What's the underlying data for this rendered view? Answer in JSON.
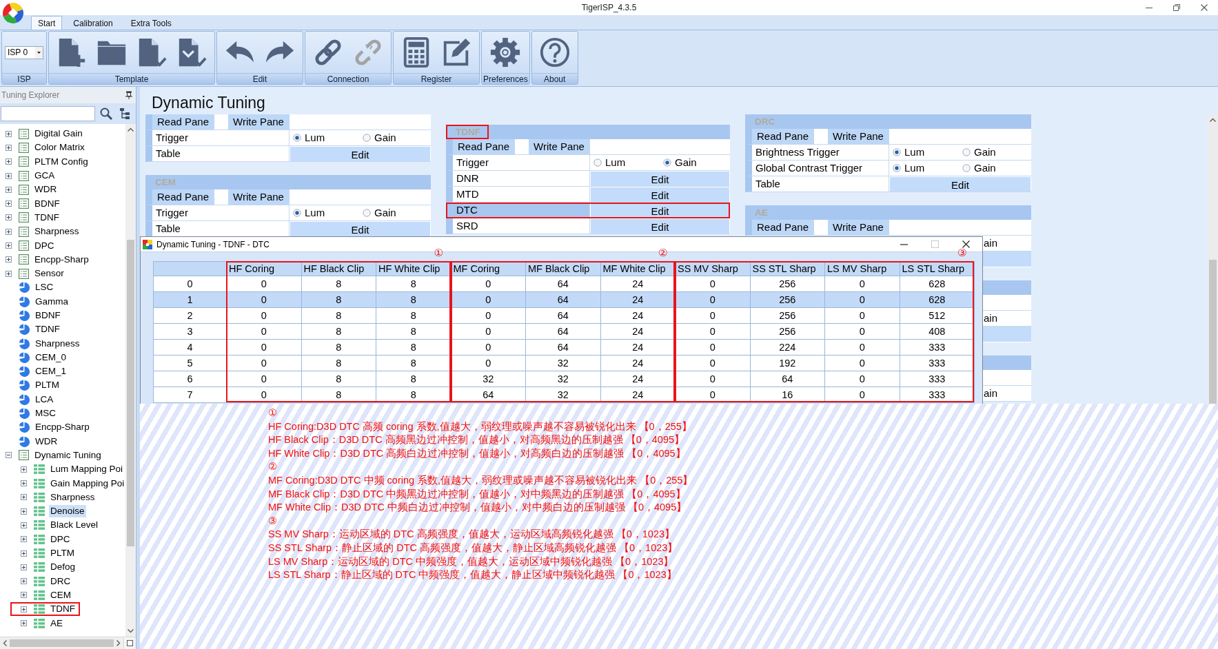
{
  "window": {
    "title": "TigerISP_4.3.5"
  },
  "ribbon": {
    "tabs": [
      {
        "label": "Start",
        "selected": true
      },
      {
        "label": "Calibration",
        "selected": false
      },
      {
        "label": "Extra Tools",
        "selected": false
      }
    ],
    "groups": [
      {
        "label": "ISP",
        "kind": "select",
        "value": "ISP 0"
      },
      {
        "label": "Template",
        "kind": "tools",
        "tools": [
          {
            "kind": "new-file",
            "disabled": false
          },
          {
            "kind": "folder",
            "disabled": false
          },
          {
            "kind": "save",
            "disabled": false
          },
          {
            "kind": "save-all",
            "disabled": false
          }
        ]
      },
      {
        "label": "Edit",
        "kind": "tools",
        "tools": [
          {
            "kind": "undo",
            "disabled": false
          },
          {
            "kind": "redo",
            "disabled": false
          }
        ]
      },
      {
        "label": "Connection",
        "kind": "tools",
        "tools": [
          {
            "kind": "link",
            "disabled": false
          },
          {
            "kind": "unlink",
            "disabled": true
          }
        ]
      },
      {
        "label": "Register",
        "kind": "tools",
        "tools": [
          {
            "kind": "calculator",
            "disabled": false
          },
          {
            "kind": "edit",
            "disabled": false
          }
        ]
      },
      {
        "label": "Preferences",
        "kind": "tools",
        "tools": [
          {
            "kind": "gear",
            "disabled": false
          }
        ]
      },
      {
        "label": "About",
        "kind": "tools",
        "tools": [
          {
            "kind": "help",
            "disabled": false
          }
        ]
      }
    ]
  },
  "explorer": {
    "title": "Tuning Explorer",
    "items": [
      {
        "label": "Digital Gain",
        "kind": "table",
        "expanded": false,
        "selected": false,
        "marked": false
      },
      {
        "label": "Color Matrix",
        "kind": "table",
        "expanded": false,
        "selected": false,
        "marked": false
      },
      {
        "label": "PLTM Config",
        "kind": "table",
        "expanded": false,
        "selected": false,
        "marked": false
      },
      {
        "label": "GCA",
        "kind": "table",
        "expanded": false,
        "selected": false,
        "marked": false
      },
      {
        "label": "WDR",
        "kind": "table",
        "expanded": false,
        "selected": false,
        "marked": false
      },
      {
        "label": "BDNF",
        "kind": "table",
        "expanded": false,
        "selected": false,
        "marked": false
      },
      {
        "label": "TDNF",
        "kind": "table",
        "expanded": false,
        "selected": false,
        "marked": false
      },
      {
        "label": "Sharpness",
        "kind": "table",
        "expanded": false,
        "selected": false,
        "marked": false
      },
      {
        "label": "DPC",
        "kind": "table",
        "expanded": false,
        "selected": false,
        "marked": false
      },
      {
        "label": "Encpp-Sharp",
        "kind": "table",
        "expanded": false,
        "selected": false,
        "marked": false
      },
      {
        "label": "Sensor",
        "kind": "table",
        "expanded": false,
        "selected": false,
        "marked": false
      },
      {
        "label": "LSC",
        "kind": "curve",
        "selected": false,
        "marked": false
      },
      {
        "label": "Gamma",
        "kind": "curve",
        "selected": false,
        "marked": false
      },
      {
        "label": "BDNF",
        "kind": "curve",
        "selected": false,
        "marked": false
      },
      {
        "label": "TDNF",
        "kind": "curve",
        "selected": false,
        "marked": false
      },
      {
        "label": "Sharpness",
        "kind": "curve",
        "selected": false,
        "marked": false
      },
      {
        "label": "CEM_0",
        "kind": "curve",
        "selected": false,
        "marked": false
      },
      {
        "label": "CEM_1",
        "kind": "curve",
        "selected": false,
        "marked": false
      },
      {
        "label": "PLTM",
        "kind": "curve",
        "selected": false,
        "marked": false
      },
      {
        "label": "LCA",
        "kind": "curve",
        "selected": false,
        "marked": false
      },
      {
        "label": "MSC",
        "kind": "curve",
        "selected": false,
        "marked": false
      },
      {
        "label": "Encpp-Sharp",
        "kind": "curve",
        "selected": false,
        "marked": false
      },
      {
        "label": "WDR",
        "kind": "curve",
        "selected": false,
        "marked": false
      },
      {
        "label": "Dynamic Tuning",
        "kind": "table",
        "expanded": true,
        "selected": false,
        "marked": false,
        "children": [
          {
            "label": "Lum Mapping Poi",
            "kind": "dynamic",
            "expanded": false,
            "selected": false,
            "marked": false
          },
          {
            "label": "Gain Mapping Poi",
            "kind": "dynamic",
            "expanded": false,
            "selected": false,
            "marked": false
          },
          {
            "label": "Sharpness",
            "kind": "dynamic",
            "expanded": false,
            "selected": false,
            "marked": false
          },
          {
            "label": "Denoise",
            "kind": "dynamic",
            "expanded": false,
            "selected": true,
            "marked": false
          },
          {
            "label": "Black Level",
            "kind": "dynamic",
            "expanded": false,
            "selected": false,
            "marked": false
          },
          {
            "label": "DPC",
            "kind": "dynamic",
            "expanded": false,
            "selected": false,
            "marked": false
          },
          {
            "label": "PLTM",
            "kind": "dynamic",
            "expanded": false,
            "selected": false,
            "marked": false
          },
          {
            "label": "Defog",
            "kind": "dynamic",
            "expanded": false,
            "selected": false,
            "marked": false
          },
          {
            "label": "DRC",
            "kind": "dynamic",
            "expanded": false,
            "selected": false,
            "marked": false
          },
          {
            "label": "CEM",
            "kind": "dynamic",
            "expanded": false,
            "selected": false,
            "marked": false
          },
          {
            "label": "TDNF",
            "kind": "dynamic",
            "expanded": false,
            "selected": false,
            "marked": true
          },
          {
            "label": "AE",
            "kind": "dynamic",
            "expanded": false,
            "selected": false,
            "marked": false
          }
        ]
      }
    ]
  },
  "page": {
    "title": "Dynamic Tuning",
    "columns": [
      {
        "panels": [
          {
            "read_pane": "Read Pane",
            "write_pane": "Write Pane",
            "rows": [
              {
                "kind": "trigger",
                "label": "Trigger",
                "selected": false,
                "marked": false,
                "options": [
                  {
                    "label": "Lum",
                    "selected": true
                  },
                  {
                    "label": "Gain",
                    "selected": false
                  }
                ]
              },
              {
                "kind": "edit",
                "label": "Table",
                "button": "Edit",
                "selected": false,
                "marked": false
              }
            ]
          },
          {
            "title": "CEM",
            "title_marked": false,
            "read_pane": "Read Pane",
            "write_pane": "Write Pane",
            "rows": [
              {
                "kind": "trigger",
                "label": "Trigger",
                "selected": false,
                "marked": false,
                "options": [
                  {
                    "label": "Lum",
                    "selected": true
                  },
                  {
                    "label": "Gain",
                    "selected": false
                  }
                ]
              },
              {
                "kind": "edit",
                "label": "Table",
                "button": "Edit",
                "selected": false,
                "marked": false
              }
            ]
          }
        ]
      },
      {
        "panels": [
          {
            "title": "TDNF",
            "title_marked": true,
            "read_pane": "Read Pane",
            "write_pane": "Write Pane",
            "rows": [
              {
                "kind": "trigger",
                "label": "Trigger",
                "selected": false,
                "marked": false,
                "options": [
                  {
                    "label": "Lum",
                    "selected": false
                  },
                  {
                    "label": "Gain",
                    "selected": true
                  }
                ]
              },
              {
                "kind": "edit",
                "label": "DNR",
                "button": "Edit",
                "selected": false,
                "marked": false
              },
              {
                "kind": "edit",
                "label": "MTD",
                "button": "Edit",
                "selected": false,
                "marked": false
              },
              {
                "kind": "edit",
                "label": "DTC",
                "button": "Edit",
                "selected": true,
                "marked": true
              },
              {
                "kind": "edit",
                "label": "SRD",
                "button": "Edit",
                "selected": false,
                "marked": false
              }
            ]
          }
        ]
      },
      {
        "panels": [
          {
            "title": "DRC",
            "title_marked": false,
            "read_pane": "Read Pane",
            "write_pane": "Write Pane",
            "rows": [
              {
                "kind": "trigger",
                "label": "Brightness Trigger",
                "selected": false,
                "marked": false,
                "options": [
                  {
                    "label": "Lum",
                    "selected": true
                  },
                  {
                    "label": "Gain",
                    "selected": false
                  }
                ]
              },
              {
                "kind": "trigger",
                "label": "Global Contrast Trigger",
                "selected": false,
                "marked": false,
                "options": [
                  {
                    "label": "Lum",
                    "selected": true
                  },
                  {
                    "label": "Gain",
                    "selected": false
                  }
                ]
              },
              {
                "kind": "edit",
                "label": "Table",
                "button": "Edit",
                "selected": false,
                "marked": false
              }
            ]
          },
          {
            "title": "AE",
            "title_marked": false,
            "read_pane": "Read Pane",
            "write_pane": "Write Pane",
            "rows": [
              {
                "kind": "covered",
                "text": "ain"
              },
              {
                "kind": "covered-edit"
              }
            ]
          },
          {
            "rows": [
              {
                "kind": "covered-header"
              },
              {
                "kind": "covered"
              },
              {
                "kind": "covered",
                "text": "ain"
              },
              {
                "kind": "covered-edit"
              }
            ]
          },
          {
            "rows": [
              {
                "kind": "covered-header"
              },
              {
                "kind": "covered"
              },
              {
                "kind": "covered",
                "text": "ain"
              }
            ]
          }
        ]
      }
    ]
  },
  "dialog": {
    "title": "Dynamic Tuning - TDNF - DTC",
    "controls": [
      {
        "kind": "minimize",
        "disabled": false
      },
      {
        "kind": "maximize",
        "disabled": true
      },
      {
        "kind": "close",
        "disabled": false
      }
    ],
    "table": {
      "groups": [
        {
          "label": "①",
          "marked": true,
          "columns": [
            "HF Coring",
            "HF Black Clip",
            "HF White Clip"
          ]
        },
        {
          "label": "②",
          "marked": true,
          "columns": [
            "MF Coring",
            "MF Black Clip",
            "MF White Clip"
          ]
        },
        {
          "label": "③",
          "marked": true,
          "columns": [
            "SS MV Sharp",
            "SS STL Sharp",
            "LS MV Sharp",
            "LS STL Sharp"
          ]
        }
      ],
      "rows": [
        {
          "index": "0",
          "selected": false,
          "cells": [
            "0",
            "8",
            "8",
            "0",
            "64",
            "24",
            "0",
            "256",
            "0",
            "628"
          ]
        },
        {
          "index": "1",
          "selected": true,
          "cells": [
            "0",
            "8",
            "8",
            "0",
            "64",
            "24",
            "0",
            "256",
            "0",
            "628"
          ]
        },
        {
          "index": "2",
          "selected": false,
          "cells": [
            "0",
            "8",
            "8",
            "0",
            "64",
            "24",
            "0",
            "256",
            "0",
            "512"
          ]
        },
        {
          "index": "3",
          "selected": false,
          "cells": [
            "0",
            "8",
            "8",
            "0",
            "64",
            "24",
            "0",
            "256",
            "0",
            "408"
          ]
        },
        {
          "index": "4",
          "selected": false,
          "cells": [
            "0",
            "8",
            "8",
            "0",
            "64",
            "24",
            "0",
            "224",
            "0",
            "333"
          ]
        },
        {
          "index": "5",
          "selected": false,
          "cells": [
            "0",
            "8",
            "8",
            "0",
            "32",
            "24",
            "0",
            "192",
            "0",
            "333"
          ]
        },
        {
          "index": "6",
          "selected": false,
          "cells": [
            "0",
            "8",
            "8",
            "32",
            "32",
            "24",
            "0",
            "64",
            "0",
            "333"
          ]
        },
        {
          "index": "7",
          "selected": false,
          "cells": [
            "0",
            "8",
            "8",
            "64",
            "32",
            "24",
            "0",
            "16",
            "0",
            "333"
          ]
        }
      ]
    }
  },
  "notes": {
    "lines": [
      "①",
      "HF Coring:D3D DTC 高频 coring 系数,值越大，弱纹理或噪声越不容易被锐化出来 【0，255】",
      "HF Black Clip：D3D DTC 高频黑边过冲控制，值越小，对高频黑边的压制越强 【0，4095】",
      "HF White Clip：D3D DTC 高频白边过冲控制，值越小，对高频白边的压制越强 【0，4095】",
      "②",
      "MF Coring:D3D DTC 中频 coring 系数,值越大，弱纹理或噪声越不容易被锐化出来 【0，255】",
      "MF Black Clip：D3D DTC 中频黑边过冲控制，值越小，对中频黑边的压制越强 【0，4095】",
      "MF White Clip：D3D DTC 中频白边过冲控制，值越小，对中频白边的压制越强 【0，4095】",
      "③",
      "SS MV Sharp：运动区域的 DTC 高频强度，值越大，运动区域高频锐化越强 【0，1023】",
      "SS STL Sharp：静止区域的 DTC 高频强度，值越大，静止区域高频锐化越强 【0，1023】",
      "LS MV Sharp：运动区域的 DTC 中频强度，值越大，运动区域中频锐化越强 【0，1023】",
      "LS STL Sharp：静止区域的 DTC 中频强度，值越大，静止区域中频锐化越强 【0，1023】"
    ]
  }
}
